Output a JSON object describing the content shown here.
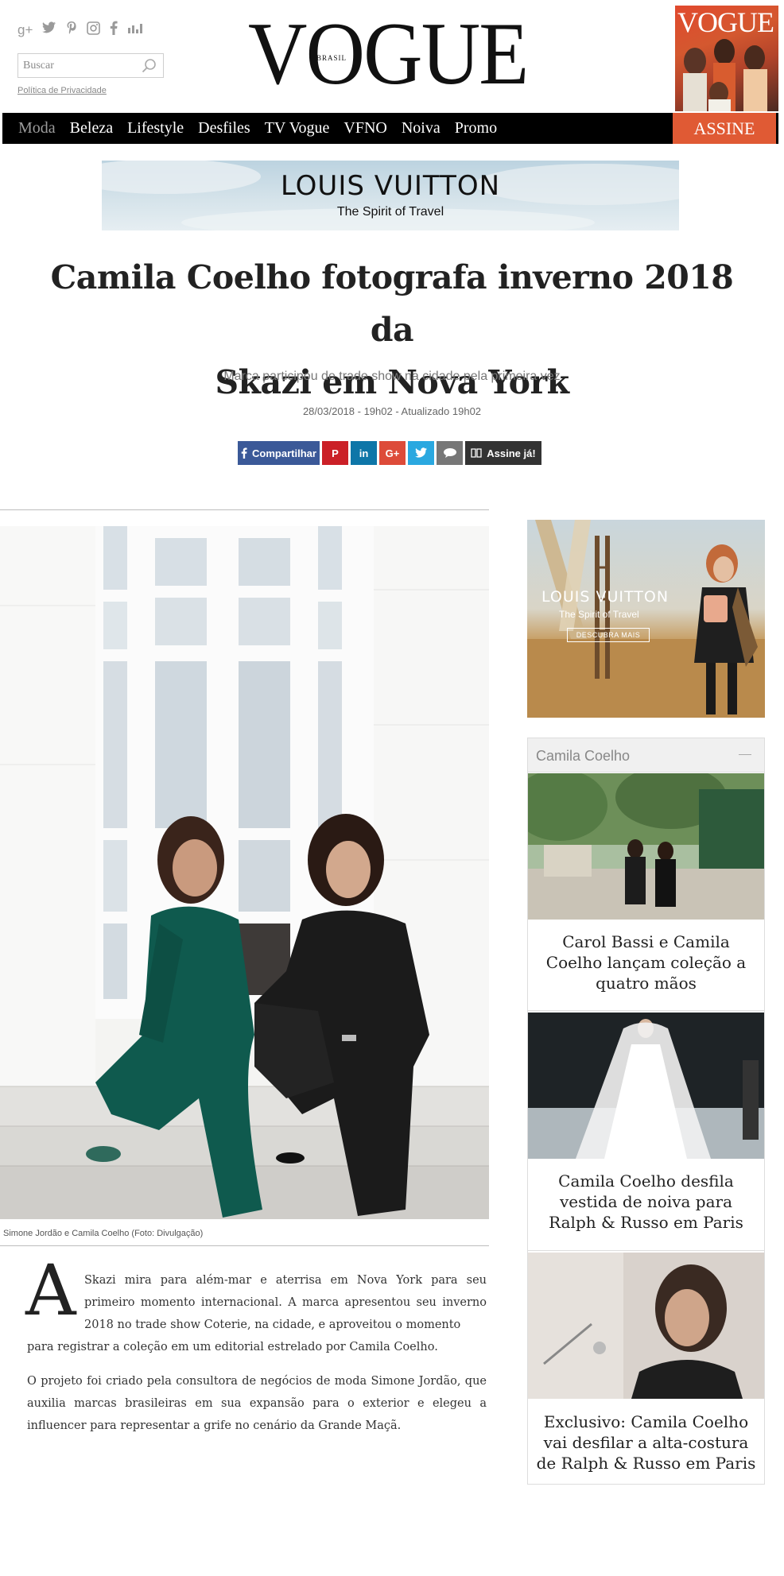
{
  "header": {
    "social_icons": [
      "google-plus-icon",
      "twitter-icon",
      "pinterest-icon",
      "instagram-icon",
      "facebook-icon",
      "stats-icon"
    ],
    "search": {
      "placeholder": "Buscar"
    },
    "privacy_link": "Política de Privacidade",
    "logo_text": "VOGUE",
    "logo_sub": "BRASIL",
    "cover": {
      "title": "VOGUE"
    }
  },
  "nav": {
    "items": [
      {
        "label": "Moda",
        "active": true
      },
      {
        "label": "Beleza"
      },
      {
        "label": "Lifestyle"
      },
      {
        "label": "Desfiles"
      },
      {
        "label": "TV Vogue"
      },
      {
        "label": "VFNO"
      },
      {
        "label": "Noiva"
      },
      {
        "label": "Promo"
      }
    ],
    "subscribe_label": "ASSINE"
  },
  "banner": {
    "brand": "LOUIS VUITTON",
    "tagline": "The Spirit of Travel"
  },
  "article": {
    "title_line1": "Camila Coelho fotografa inverno 2018 da",
    "title_line2": "Skazi em Nova York",
    "subtitle": "Marca participou de trade show na cidade pela primeira vez",
    "dateline": "28/03/2018 - 19h02 - Atualizado 19h02",
    "caption": "Simone Jordão e Camila Coelho (Foto: Divulgação)",
    "dropcap": "A",
    "para1_first": "Skazi mira para além-mar e aterrisa em Nova York para seu primeiro momento internacional. A marca apresentou seu inverno 2018 no trade show Coterie, na cidade, e aproveitou o momento",
    "para1_last": "para registrar a coleção em um editorial estrelado por Camila Coelho.",
    "para2": "O projeto foi criado pela consultora de negócios de moda Simone Jordão, que auxilia marcas brasileiras em sua expansão para o exterior e elegeu a influencer para representar a grife no cenário da Grande Maçã."
  },
  "share": {
    "facebook_label": "Compartilhar",
    "pinterest_label": "P",
    "linkedin_label": "in",
    "googleplus_label": "G+",
    "subscribe_label": "Assine já!"
  },
  "sidebar": {
    "ad": {
      "brand": "LOUIS VUITTON",
      "tagline": "The Spirit of Travel",
      "button": "DESCUBRA MAIS"
    },
    "related": {
      "heading": "Camila Coelho",
      "items": [
        {
          "title": "Carol Bassi e Camila Coelho lançam coleção a quatro mãos"
        },
        {
          "title": "Camila Coelho desfila vestida de noiva para Ralph & Russo em Paris"
        },
        {
          "title": "Exclusivo: Camila Coelho vai desfilar a alta-costura de Ralph & Russo em Paris"
        }
      ]
    }
  },
  "colors": {
    "nav_bg": "#000000",
    "subscribe_bg": "#e05a34",
    "facebook": "#3b5998",
    "pinterest": "#cb2027",
    "linkedin": "#0e76a8",
    "googleplus": "#dd4b39",
    "twitter": "#2aa8e0"
  }
}
